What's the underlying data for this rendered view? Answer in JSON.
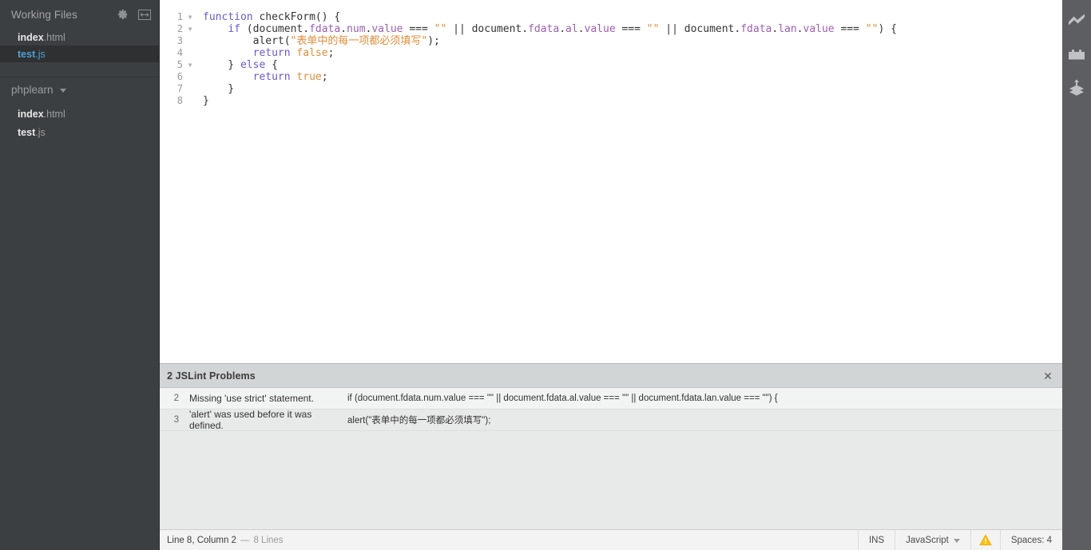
{
  "sidebar": {
    "working_files_title": "Working Files",
    "header_icons": [
      {
        "name": "gear-icon",
        "label": "Settings"
      },
      {
        "name": "split-view-icon",
        "label": "Split View"
      }
    ],
    "working_files": [
      {
        "base": "index",
        "ext": ".html",
        "selected": false
      },
      {
        "base": "test",
        "ext": ".js",
        "selected": true
      }
    ],
    "project": {
      "name": "phplearn",
      "files": [
        {
          "base": "index",
          "ext": ".html"
        },
        {
          "base": "test",
          "ext": ".js"
        }
      ]
    }
  },
  "editor": {
    "filename": "test.js",
    "lines": [
      {
        "num": "1",
        "fold": "▼",
        "tokens": [
          {
            "t": "function",
            "c": "kw"
          },
          {
            "t": " ",
            "c": "plain"
          },
          {
            "t": "checkForm",
            "c": "def"
          },
          {
            "t": "() {",
            "c": "punc"
          }
        ]
      },
      {
        "num": "2",
        "fold": "▼",
        "tokens": [
          {
            "t": "    ",
            "c": "plain"
          },
          {
            "t": "if",
            "c": "kw"
          },
          {
            "t": " (",
            "c": "punc"
          },
          {
            "t": "document",
            "c": "plain"
          },
          {
            "t": ".",
            "c": "punc"
          },
          {
            "t": "fdata",
            "c": "prop"
          },
          {
            "t": ".",
            "c": "punc"
          },
          {
            "t": "num",
            "c": "prop"
          },
          {
            "t": ".",
            "c": "punc"
          },
          {
            "t": "value",
            "c": "prop"
          },
          {
            "t": " === ",
            "c": "op"
          },
          {
            "t": "\"\"",
            "c": "str"
          },
          {
            "t": " || ",
            "c": "op"
          },
          {
            "t": "document",
            "c": "plain"
          },
          {
            "t": ".",
            "c": "punc"
          },
          {
            "t": "fdata",
            "c": "prop"
          },
          {
            "t": ".",
            "c": "punc"
          },
          {
            "t": "al",
            "c": "prop"
          },
          {
            "t": ".",
            "c": "punc"
          },
          {
            "t": "value",
            "c": "prop"
          },
          {
            "t": " === ",
            "c": "op"
          },
          {
            "t": "\"\"",
            "c": "str"
          },
          {
            "t": " || ",
            "c": "op"
          },
          {
            "t": "document",
            "c": "plain"
          },
          {
            "t": ".",
            "c": "punc"
          },
          {
            "t": "fdata",
            "c": "prop"
          },
          {
            "t": ".",
            "c": "punc"
          },
          {
            "t": "lan",
            "c": "prop"
          },
          {
            "t": ".",
            "c": "punc"
          },
          {
            "t": "value",
            "c": "prop"
          },
          {
            "t": " === ",
            "c": "op"
          },
          {
            "t": "\"\"",
            "c": "str"
          },
          {
            "t": ") {",
            "c": "punc"
          }
        ]
      },
      {
        "num": "3",
        "fold": "",
        "tokens": [
          {
            "t": "        alert(",
            "c": "plain"
          },
          {
            "t": "\"表单中的每一项都必须填写\"",
            "c": "str"
          },
          {
            "t": ");",
            "c": "punc"
          }
        ]
      },
      {
        "num": "4",
        "fold": "",
        "tokens": [
          {
            "t": "        ",
            "c": "plain"
          },
          {
            "t": "return",
            "c": "kw"
          },
          {
            "t": " ",
            "c": "plain"
          },
          {
            "t": "false",
            "c": "lit"
          },
          {
            "t": ";",
            "c": "punc"
          }
        ]
      },
      {
        "num": "5",
        "fold": "▼",
        "tokens": [
          {
            "t": "    } ",
            "c": "punc"
          },
          {
            "t": "else",
            "c": "kw"
          },
          {
            "t": " {",
            "c": "punc"
          }
        ]
      },
      {
        "num": "6",
        "fold": "",
        "tokens": [
          {
            "t": "        ",
            "c": "plain"
          },
          {
            "t": "return",
            "c": "kw"
          },
          {
            "t": " ",
            "c": "plain"
          },
          {
            "t": "true",
            "c": "lit"
          },
          {
            "t": ";",
            "c": "punc"
          }
        ]
      },
      {
        "num": "7",
        "fold": "",
        "tokens": [
          {
            "t": "    }",
            "c": "punc"
          }
        ]
      },
      {
        "num": "8",
        "fold": "",
        "tokens": [
          {
            "t": "}",
            "c": "punc"
          }
        ]
      }
    ]
  },
  "jslint": {
    "title": "2 JSLint Problems",
    "close_label": "✕",
    "problems": [
      {
        "line": "2",
        "message": "Missing 'use strict' statement.",
        "code": "if (document.fdata.num.value === \"\" || document.fdata.al.value === \"\" || document.fdata.lan.value === \"\") {"
      },
      {
        "line": "3",
        "message": "'alert' was used before it was defined.",
        "code": "alert(\"表单中的每一项都必须填写\");"
      }
    ]
  },
  "statusbar": {
    "cursor": "Line 8, Column 2",
    "dash": "—",
    "line_count": "8 Lines",
    "insert_mode": "INS",
    "language": "JavaScript",
    "indent": "Spaces: 4"
  },
  "right_toolbar": [
    {
      "name": "live-preview-icon",
      "label": "Live Preview"
    },
    {
      "name": "extension-manager-icon",
      "label": "Extension Manager"
    },
    {
      "name": "deploy-upload-icon",
      "label": "Deploy"
    }
  ],
  "colors": {
    "sidebar_bg": "#3c3f41",
    "selected_file": "#4ea1d3",
    "accent_warning": "#ffc000",
    "string_token": "#e08e3c",
    "keyword_token": "#6a5acd",
    "property_token": "#9b5fb0"
  }
}
